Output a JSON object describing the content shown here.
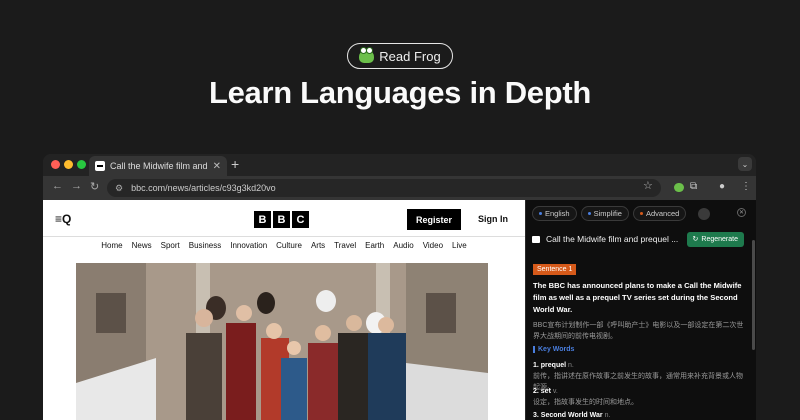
{
  "hero": {
    "badge": "Read Frog",
    "headline": "Learn Languages in Depth"
  },
  "browser": {
    "tab_title": "Call the Midwife film and pre",
    "tab_close": "✕",
    "new_tab": "+",
    "url": "bbc.com/news/articles/c93g3kd20vo"
  },
  "bbc": {
    "logo_letters": [
      "B",
      "B",
      "C"
    ],
    "register": "Register",
    "sign_in": "Sign In",
    "nav": [
      "Home",
      "News",
      "Sport",
      "Business",
      "Innovation",
      "Culture",
      "Arts",
      "Travel",
      "Earth",
      "Audio",
      "Video",
      "Live"
    ]
  },
  "panel": {
    "modes": [
      {
        "label": "English",
        "color": "#4a7fe0"
      },
      {
        "label": "Simplifie",
        "color": "#4a7fe0"
      },
      {
        "label": "Advanced",
        "color": "#d65a1a"
      }
    ],
    "article_title": "Call the Midwife film and prequel ...",
    "regenerate": "Regenerate",
    "sentence_tag": "Sentence 1",
    "sentence": "The BBC has announced plans to make a Call the Midwife film as well as a prequel TV series set during the Second World War.",
    "translation": "BBC宣布计划制作一部《呼叫助产士》电影以及一部设定在第二次世界大战期间的前传电视剧。",
    "key_words_heading": "Key Words",
    "key_words": [
      {
        "term": "1. prequel",
        "pos": "n.",
        "definition": "前传，指讲述在原作故事之前发生的故事，通常用来补充背景或人物起源。"
      },
      {
        "term": "2. set",
        "pos": "v.",
        "definition": "设定，指故事发生的时间和地点。"
      },
      {
        "term": "3. Second World War",
        "pos": "n.",
        "definition": ""
      }
    ]
  },
  "colors": {
    "background": "#1b1b1b",
    "frog_green": "#6bbf4a",
    "regenerate_green": "#1e7a4d",
    "sentence_orange": "#d65a1a",
    "keyword_blue": "#4a7fe0"
  }
}
